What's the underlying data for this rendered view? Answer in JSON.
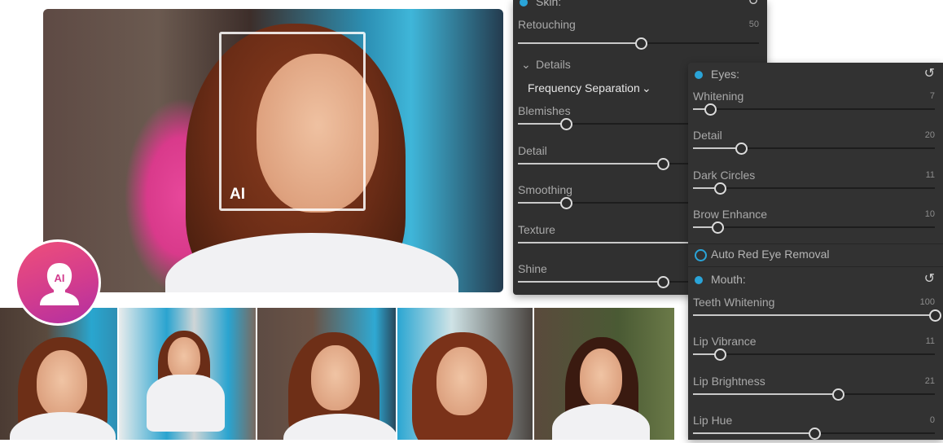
{
  "hero": {
    "ai_label": "AI"
  },
  "skin": {
    "title": "Skin:",
    "retouching": {
      "label": "Retouching",
      "value": "50",
      "level": 0.51
    },
    "details_label": "Details",
    "mode_label": "Frequency Separation",
    "controls": [
      {
        "label": "Blemishes",
        "level": 0.2
      },
      {
        "label": "Detail",
        "level": 0.6
      },
      {
        "label": "Smoothing",
        "level": 0.2
      },
      {
        "label": "Texture",
        "level": 1.0
      },
      {
        "label": "Shine",
        "level": 0.6
      }
    ]
  },
  "eyes": {
    "title": "Eyes:",
    "controls": [
      {
        "label": "Whitening",
        "value": "7",
        "level": 0.07
      },
      {
        "label": "Detail",
        "value": "20",
        "level": 0.2
      },
      {
        "label": "Dark Circles",
        "value": "11",
        "level": 0.11
      },
      {
        "label": "Brow Enhance",
        "value": "10",
        "level": 0.1
      }
    ],
    "red_eye_label": "Auto Red Eye Removal"
  },
  "mouth": {
    "title": "Mouth:",
    "controls": [
      {
        "label": "Teeth Whitening",
        "value": "100",
        "level": 1.0
      },
      {
        "label": "Lip Vibrance",
        "value": "11",
        "level": 0.11
      },
      {
        "label": "Lip Brightness",
        "value": "21",
        "level": 0.6
      },
      {
        "label": "Lip Hue",
        "value": "0",
        "level": 0.5
      }
    ]
  },
  "colors": {
    "accent": "#2aa4d8",
    "panel_bg": "#303030",
    "badge_from": "#ef4f7a",
    "badge_to": "#b22fa2"
  },
  "icons": {
    "reset": "undo-arrow-icon",
    "chevron_down": "chevron-down-icon",
    "enabled_dot": "dot-icon",
    "ai_person": "ai-person-icon"
  }
}
